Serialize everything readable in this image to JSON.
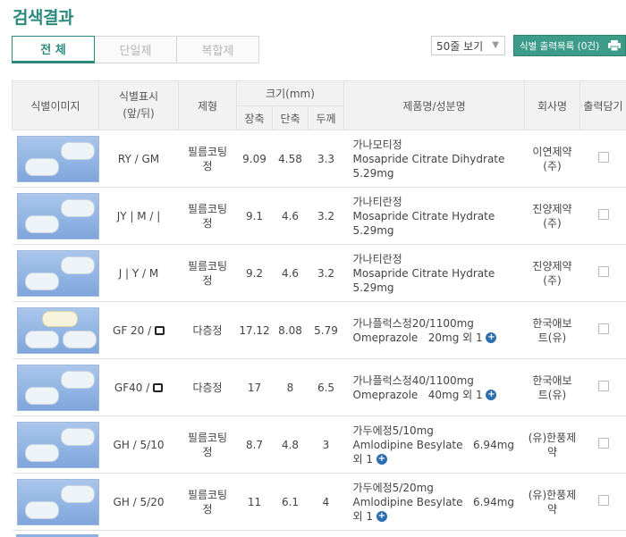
{
  "title": "검색결과",
  "tabs": [
    {
      "label": "전 체",
      "active": true
    },
    {
      "label": "단일제",
      "active": false
    },
    {
      "label": "복합제",
      "active": false
    }
  ],
  "perpage": {
    "label": "50줄 보기"
  },
  "print_list": {
    "label": "식별 출력목록 (0건)"
  },
  "headers": {
    "image": "식별이미지",
    "marking_line1": "식별표시",
    "marking_line2": "(앞/뒤)",
    "form": "제형",
    "size": "크기(mm)",
    "length": "장축",
    "width": "단축",
    "thickness": "두께",
    "name": "제품명/성분명",
    "company": "회사명",
    "print": "출력담기"
  },
  "rows": [
    {
      "marking_pre": "RY / GM",
      "marking_post": "",
      "form": "필름코팅정",
      "length": "9.09",
      "width": "4.58",
      "thick": "3.3",
      "name": "가나모티정",
      "ingredient": "Mosapride Citrate Dihydrate",
      "dose": "5.29mg",
      "more": false,
      "company": "이연제약(주)"
    },
    {
      "marking_pre": "JY | M / |",
      "marking_post": "",
      "form": "필름코팅정",
      "length": "9.1",
      "width": "4.6",
      "thick": "3.2",
      "name": "가나티란정",
      "ingredient": "Mosapride Citrate Hydrate",
      "dose": "5.29mg",
      "more": false,
      "company": "진양제약(주)"
    },
    {
      "marking_pre": "J | Y / M",
      "marking_post": "",
      "form": "필름코팅정",
      "length": "9.2",
      "width": "4.6",
      "thick": "3.2",
      "name": "가나티란정",
      "ingredient": "Mosapride Citrate Hydrate",
      "dose": "5.29mg",
      "more": false,
      "company": "진양제약(주)"
    },
    {
      "marking_pre": "GF 20 / ",
      "marking_post": "logo",
      "form": "다층정",
      "length": "17.12",
      "width": "8.08",
      "thick": "5.79",
      "name": "가나플럭스정20/1100mg",
      "ingredient": "Omeprazole",
      "dose": "20mg 외 1",
      "more": true,
      "company": "한국애보트(유)"
    },
    {
      "marking_pre": "GF40 / ",
      "marking_post": "logo",
      "form": "다층정",
      "length": "17",
      "width": "8",
      "thick": "6.5",
      "name": "가나플럭스정40/1100mg",
      "ingredient": "Omeprazole",
      "dose": "40mg 외 1",
      "more": true,
      "company": "한국애보트(유)"
    },
    {
      "marking_pre": "GH / 5/10",
      "marking_post": "",
      "form": "필름코팅정",
      "length": "8.7",
      "width": "4.8",
      "thick": "3",
      "name": "가두에정5/10mg",
      "ingredient": "Amlodipine Besylate",
      "dose": "6.94mg 외 1",
      "more": true,
      "company": "(유)한풍제약"
    },
    {
      "marking_pre": "GH / 5/20",
      "marking_post": "",
      "form": "필름코팅정",
      "length": "11",
      "width": "6.1",
      "thick": "4",
      "name": "가두에정5/20mg",
      "ingredient": "Amlodipine Besylate",
      "dose": "6.94mg 외 1",
      "more": true,
      "company": "(유)한풍제약"
    }
  ]
}
